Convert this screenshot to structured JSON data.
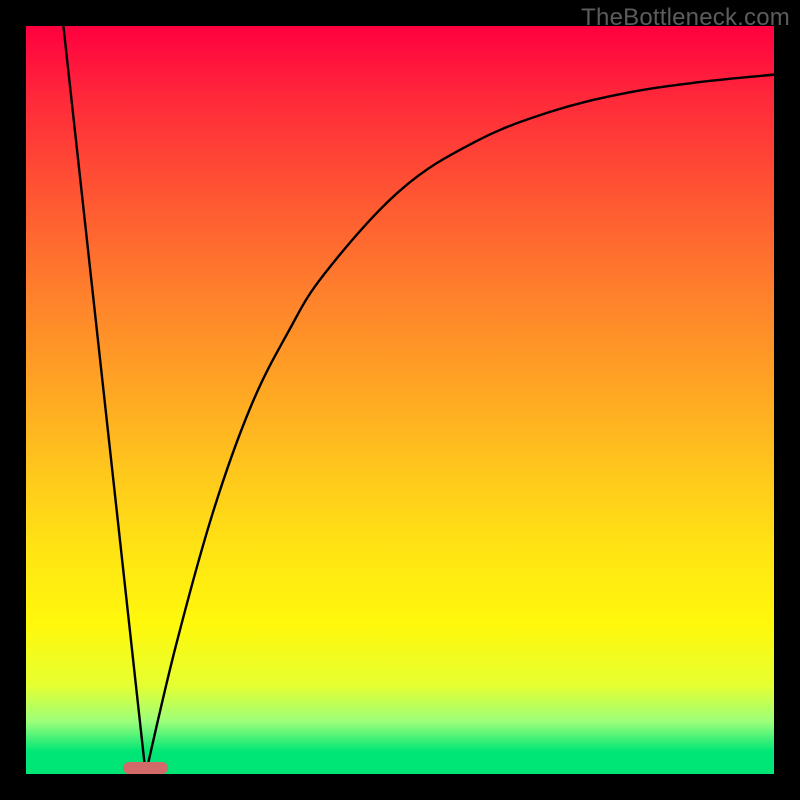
{
  "watermark": "TheBottleneck.com",
  "colors": {
    "frame": "#000000",
    "marker": "#d36a6a",
    "curve": "#000000",
    "gradient_top": "#ff003f",
    "gradient_bottom": "#00e676"
  },
  "chart_data": {
    "type": "line",
    "title": "",
    "xlabel": "",
    "ylabel": "",
    "xlim": [
      0,
      100
    ],
    "ylim": [
      0,
      100
    ],
    "marker": {
      "x_center": 16,
      "width": 6
    },
    "series": [
      {
        "name": "left-line",
        "x": [
          5,
          16
        ],
        "y": [
          100,
          0
        ]
      },
      {
        "name": "right-curve",
        "x": [
          16,
          20,
          25,
          30,
          35,
          40,
          50,
          60,
          70,
          80,
          90,
          100
        ],
        "y": [
          0,
          17,
          35,
          49,
          59,
          67,
          78,
          84.5,
          88.5,
          91,
          92.5,
          93.5
        ]
      }
    ]
  }
}
